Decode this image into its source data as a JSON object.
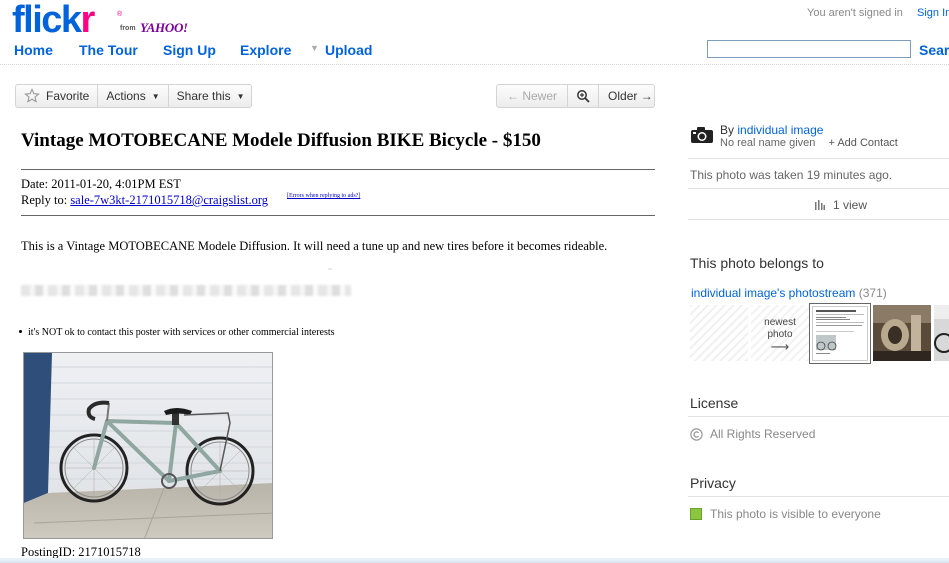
{
  "header": {
    "logo": {
      "flickr_dark": "flick",
      "flickr_pink": "r",
      "reg": "®",
      "from": "from",
      "yahoo": "YAHOO!"
    },
    "nav": [
      {
        "label": "Home"
      },
      {
        "label": "The Tour"
      },
      {
        "label": "Sign Up"
      },
      {
        "label": "Explore"
      },
      {
        "label": "Upload"
      }
    ],
    "not_signed_in": "You aren't signed in",
    "sign_in": "Sign In",
    "search_value": "",
    "search_button": "Sear"
  },
  "toolbar": {
    "favorite": "Favorite",
    "actions": "Actions",
    "share": "Share this",
    "newer": "← Newer",
    "older": "Older →"
  },
  "photo": {
    "title": "Vintage MOTOBECANE Modele Diffusion BIKE Bicycle - $150",
    "date": "Date: 2011-01-20, 4:01PM EST",
    "reply_prefix": "Reply to:",
    "reply_email": "sale-7w3kt-2171015718@craigslist.org",
    "errors_link": "[Errors when replying to ads?]",
    "body": "This is a Vintage MOTOBECANE Modele Diffusion. It will need a tune up and new tires before it becomes rideable.",
    "bullet": "it's NOT ok to contact this poster with services or other commercial interests",
    "posting_id": "PostingID: 2171015718"
  },
  "sidebar": {
    "by_prefix": "By",
    "owner": "individual image",
    "no_real_name": "No real name given",
    "add_contact": "+ Add Contact",
    "taken": "This photo was taken 19 minutes ago.",
    "views": "1 view",
    "belongs_heading": "This photo belongs to",
    "photostream": "individual image's photostream",
    "photostream_count": "(371)",
    "newest_photo": "newest photo",
    "newest_arrow": "⟶",
    "license_heading": "License",
    "license_value": "All Rights Reserved",
    "privacy_heading": "Privacy",
    "privacy_value": "This photo is visible to everyone"
  },
  "colors": {
    "link_blue": "#0063dc",
    "flickr_pink": "#ff0084",
    "privacy_green": "#8cc63f"
  }
}
